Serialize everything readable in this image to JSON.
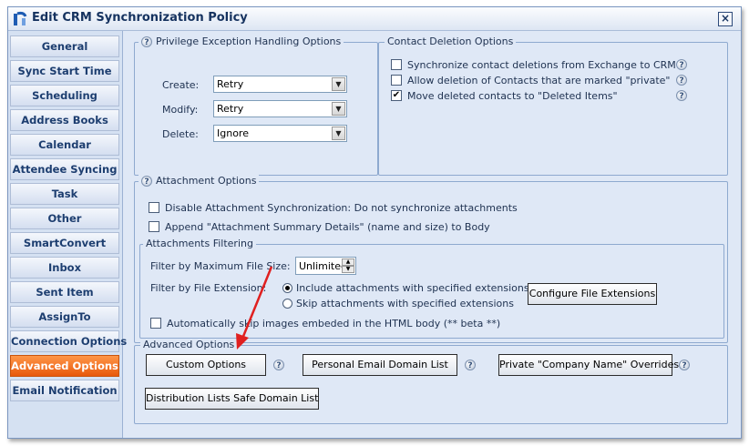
{
  "window": {
    "title": "Edit CRM Synchronization Policy",
    "close_glyph": "×"
  },
  "sidebar": {
    "items": [
      {
        "label": "General"
      },
      {
        "label": "Sync Start Time"
      },
      {
        "label": "Scheduling"
      },
      {
        "label": "Address Books"
      },
      {
        "label": "Calendar"
      },
      {
        "label": "Attendee Syncing"
      },
      {
        "label": "Task"
      },
      {
        "label": "Other"
      },
      {
        "label": "SmartConvert"
      },
      {
        "label": "Inbox"
      },
      {
        "label": "Sent Item"
      },
      {
        "label": "AssignTo"
      },
      {
        "label": "Connection Options"
      },
      {
        "label": "Advanced Options"
      },
      {
        "label": "Email Notification"
      }
    ],
    "active": "Advanced Options"
  },
  "privilege": {
    "legend": "Privilege Exception Handling Options",
    "create_label": "Create:",
    "create_value": "Retry",
    "modify_label": "Modify:",
    "modify_value": "Retry",
    "delete_label": "Delete:",
    "delete_value": "Ignore"
  },
  "contact_deletion": {
    "legend": "Contact Deletion Options",
    "options": [
      {
        "label": "Synchronize contact deletions from Exchange to CRM",
        "checked": false
      },
      {
        "label": "Allow deletion of Contacts that are marked \"private\"",
        "checked": false
      },
      {
        "label": "Move deleted contacts to \"Deleted Items\"",
        "checked": true
      }
    ]
  },
  "attachment": {
    "legend": "Attachment Options",
    "disable_label": "Disable Attachment Synchronization: Do not synchronize attachments",
    "append_label": "Append \"Attachment Summary Details\" (name and size) to Body",
    "filtering": {
      "legend": "Attachments Filtering",
      "max_size_label": "Filter by Maximum File Size:",
      "max_size_value": "Unlimited",
      "ext_label": "Filter by File Extension:",
      "include_label": "Include attachments with specified extensions",
      "skip_label": "Skip attachments with specified extensions",
      "configure_button": "Configure File Extensions",
      "skip_images_label": "Automatically skip images embeded in the HTML body (** beta **)"
    }
  },
  "advanced": {
    "legend": "Advanced Options",
    "custom_button": "Custom Options",
    "email_domain_button": "Personal Email Domain List",
    "company_button": "Private \"Company Name\" Overrides",
    "distribution_button": "Distribution Lists Safe Domain List"
  },
  "colors": {
    "active_tab": "#e8590c",
    "panel_bg": "#dfe8f6",
    "annotation_arrow": "#e02020"
  },
  "icons": {
    "help": "question-icon",
    "check": "✔"
  }
}
